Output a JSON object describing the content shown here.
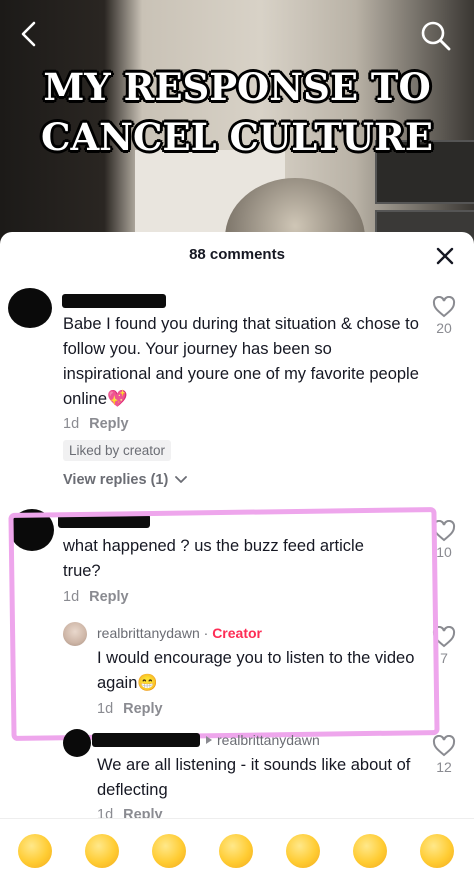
{
  "video": {
    "headline_line1": "MY RESPONSE TO",
    "headline_line2": "CANCEL CULTURE"
  },
  "comments_sheet": {
    "title": "88 comments",
    "comments": [
      {
        "text": "Babe I found you during that situation & chose to follow you. Your journey has been so inspirational and youre one of my favorite people online💖",
        "time": "1d",
        "reply_label": "Reply",
        "badge": "Liked by creator",
        "view_replies": "View replies (1)",
        "likes": "20"
      },
      {
        "text": "what happened ? us the buzz feed article true?",
        "time": "1d",
        "reply_label": "Reply",
        "likes": "10",
        "reply": {
          "username": "realbrittanydawn",
          "separator": "·",
          "creator_label": "Creator",
          "text": "I would encourage you to listen to the video again😁",
          "time": "1d",
          "reply_label": "Reply",
          "likes": "7"
        }
      },
      {
        "reply_to": "realbrittanydawn",
        "text": "We are all listening - it sounds like about of deflecting",
        "time": "1d",
        "reply_label": "Reply",
        "likes": "12"
      }
    ]
  },
  "emoji_bar": [
    "😁",
    "🥰",
    "😂",
    "😳",
    "😏",
    "😅",
    "🥺"
  ],
  "colors": {
    "creator": "#fe2c55",
    "highlight": "#eea6ec",
    "text": "#161823",
    "muted": "#8a8b91"
  }
}
